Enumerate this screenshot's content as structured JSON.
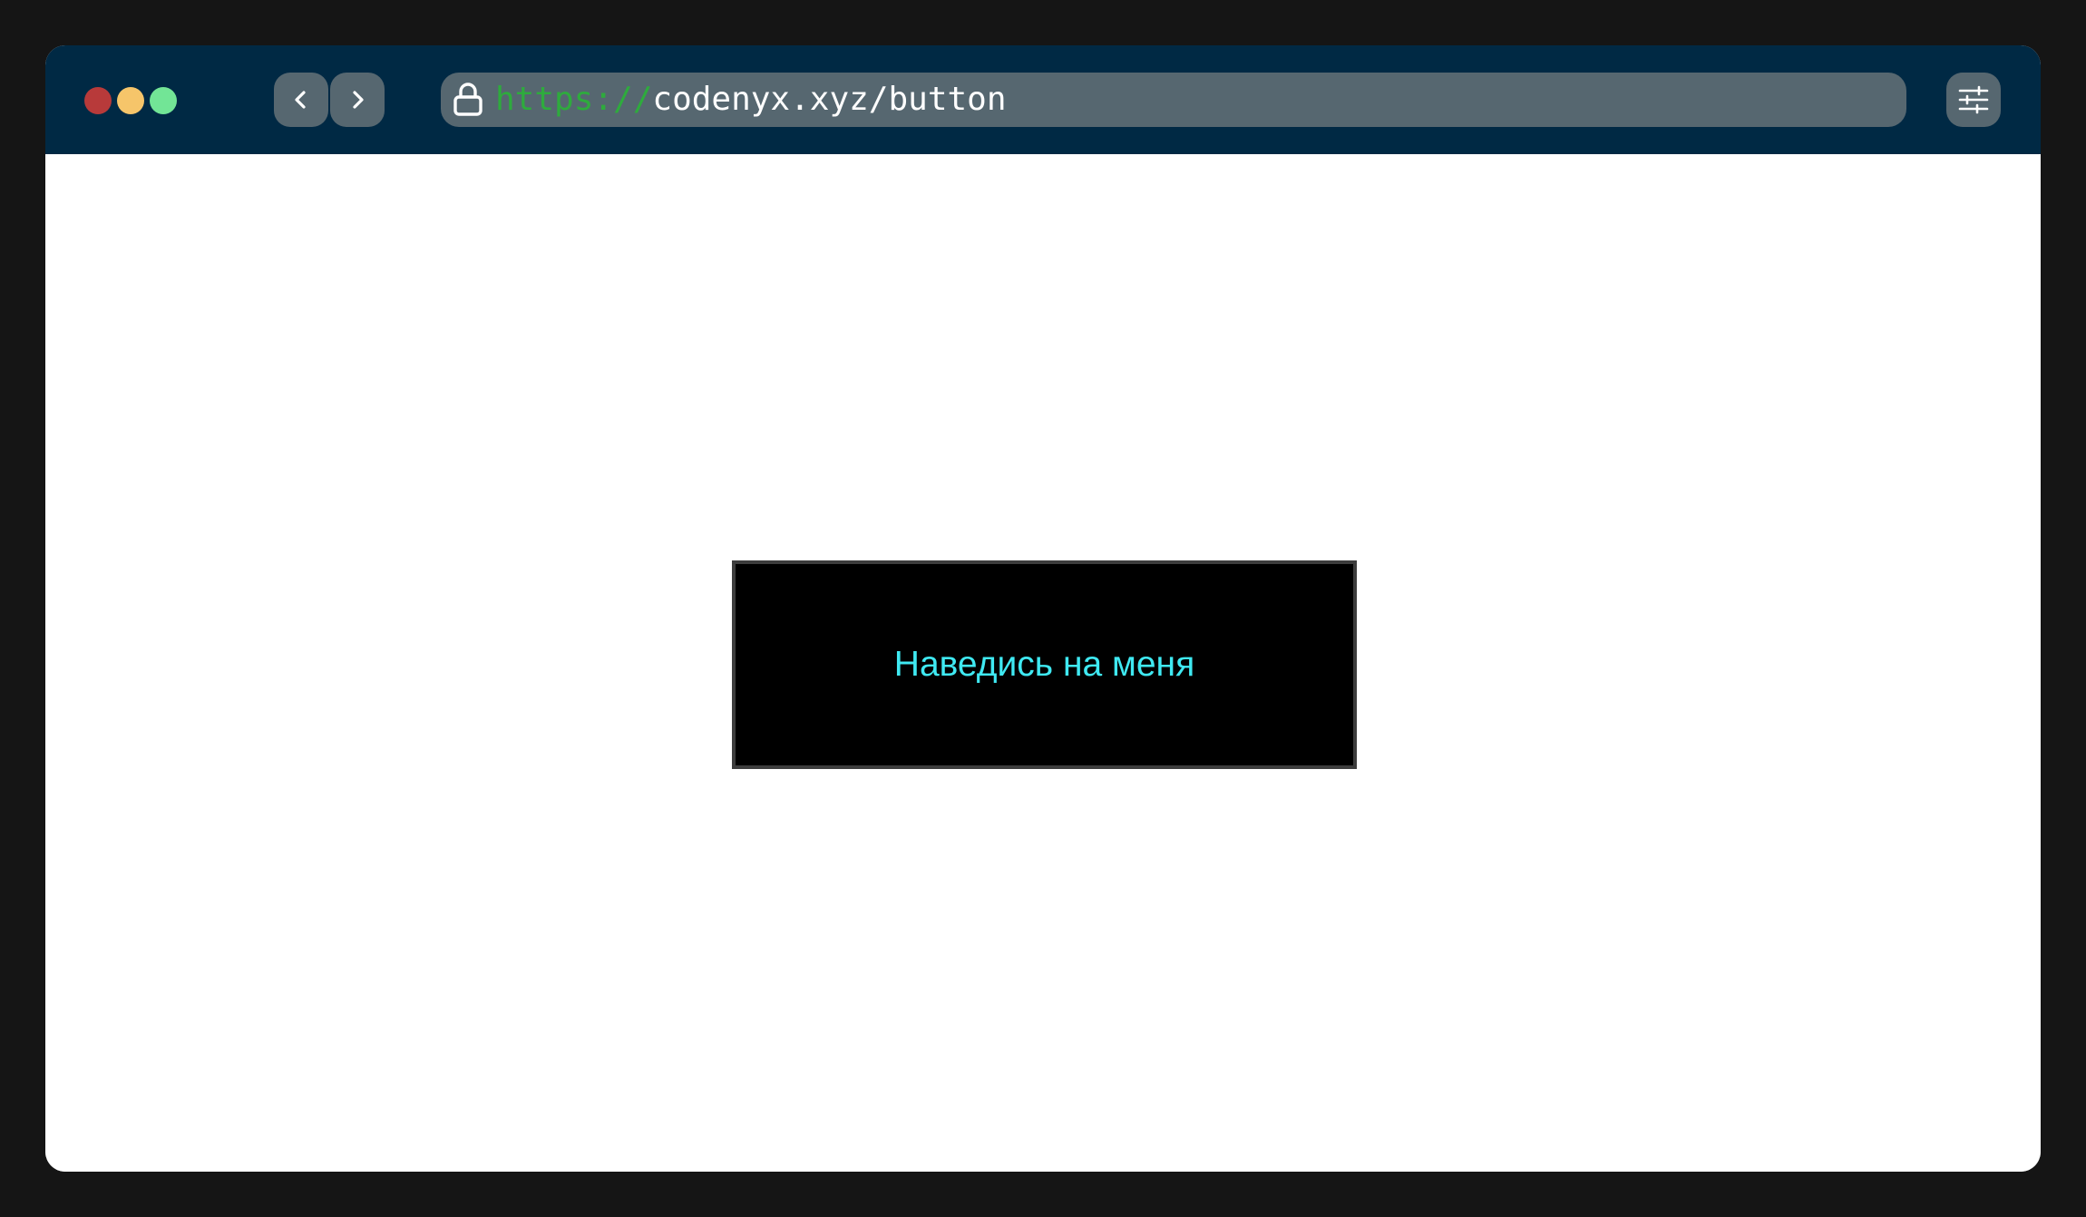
{
  "window": {
    "traffic_lights": [
      "close",
      "minimize",
      "maximize"
    ]
  },
  "toolbar": {
    "back_icon": "chevron-left-icon",
    "forward_icon": "chevron-right-icon",
    "settings_icon": "sliders-icon"
  },
  "address_bar": {
    "lock_icon": "lock-icon",
    "scheme": "https://",
    "path": "codenyx.xyz/button"
  },
  "page": {
    "button_label": "Наведись на меня"
  },
  "colors": {
    "titlebar": "#002944",
    "scheme_text": "#2eab3d",
    "button_text": "#3fe9f2"
  }
}
